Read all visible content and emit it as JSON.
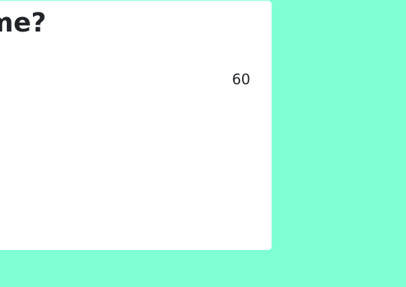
{
  "page": {
    "background_color": "#7fffd4"
  },
  "card": {
    "background_color": "#ffffff",
    "title_visible_fragment": "me?",
    "counter_value": "60"
  }
}
